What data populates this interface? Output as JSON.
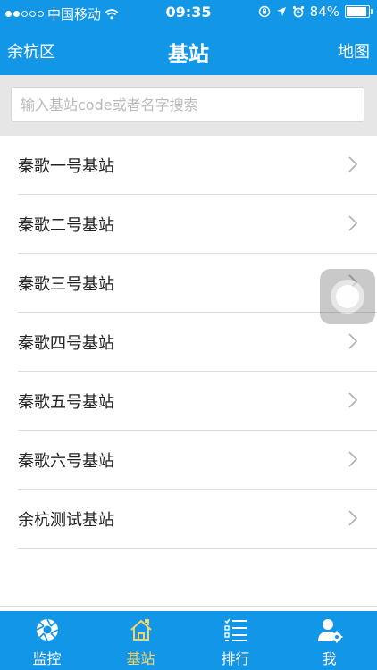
{
  "status_bar": {
    "carrier": "中国移动",
    "time": "09:35",
    "battery": "84%"
  },
  "nav": {
    "left": "余杭区",
    "title": "基站",
    "right": "地图"
  },
  "search": {
    "placeholder": "输入基站code或者名字搜索",
    "value": ""
  },
  "list": {
    "items": [
      {
        "label": "秦歌一号基站"
      },
      {
        "label": "秦歌二号基站"
      },
      {
        "label": "秦歌三号基站"
      },
      {
        "label": "秦歌四号基站"
      },
      {
        "label": "秦歌五号基站"
      },
      {
        "label": "秦歌六号基站"
      },
      {
        "label": "余杭测试基站"
      }
    ]
  },
  "tabs": [
    {
      "label": "监控",
      "icon": "aperture-icon"
    },
    {
      "label": "基站",
      "icon": "home-icon",
      "active": true
    },
    {
      "label": "排行",
      "icon": "list-icon"
    },
    {
      "label": "我",
      "icon": "user-settings-icon"
    }
  ],
  "colors": {
    "primary": "#1296e8",
    "active_tab": "#f6d365"
  }
}
